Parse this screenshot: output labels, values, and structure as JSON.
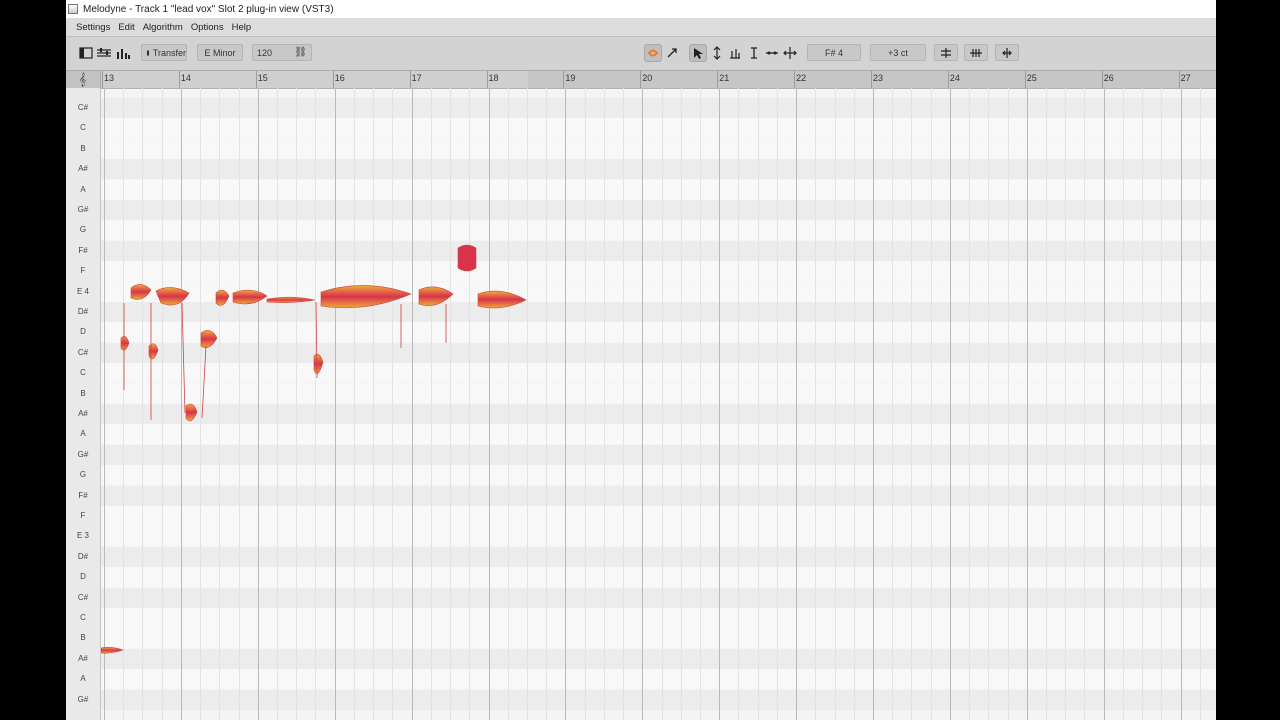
{
  "window": {
    "title": "Melodyne - Track 1 \"lead vox\" Slot 2 plug-in view (VST3)"
  },
  "menu": {
    "items": [
      "Settings",
      "Edit",
      "Algorithm",
      "Options",
      "Help"
    ]
  },
  "toolbar": {
    "transfer_label": "Transfer",
    "key_label": "E Minor",
    "tempo_value": "120",
    "pitch_value": "F# 4",
    "cents_value": "+3 ct"
  },
  "ruler": {
    "bars": [
      "13",
      "14",
      "15",
      "16",
      "17",
      "18",
      "19",
      "20",
      "21",
      "22",
      "23",
      "24",
      "25",
      "26",
      "27"
    ]
  },
  "piano_keys": [
    "C#",
    "C",
    "B",
    "A#",
    "A",
    "G#",
    "G",
    "F#",
    "F",
    "E 4",
    "D#",
    "D",
    "C#",
    "C",
    "B",
    "A#",
    "A",
    "G#",
    "G",
    "F#",
    "F",
    "E 3",
    "D#",
    "D",
    "C#",
    "C",
    "B",
    "A#",
    "A",
    "G#"
  ],
  "colors": {
    "blob_outer": "#e8a23a",
    "blob_inner": "#d9334b",
    "accent": "#f07a22"
  }
}
